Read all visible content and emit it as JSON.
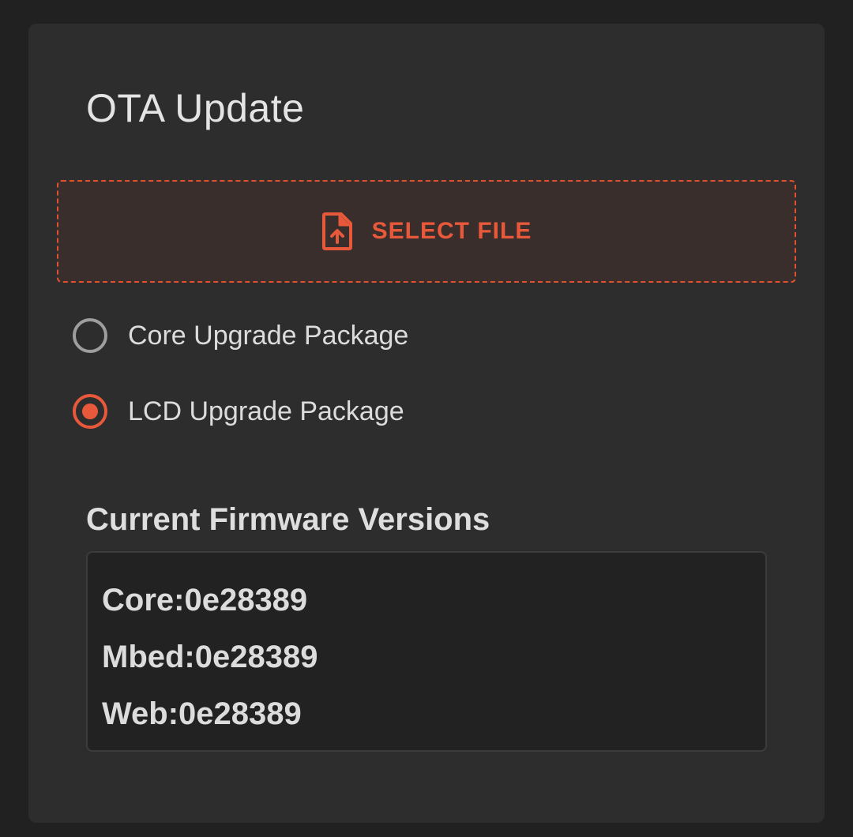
{
  "panel": {
    "title": "OTA Update",
    "select_file": {
      "icon": "file-upload-icon",
      "label": "SELECT FILE"
    },
    "package_options": [
      {
        "label": "Core Upgrade Package",
        "selected": false
      },
      {
        "label": "LCD Upgrade Package",
        "selected": true
      }
    ],
    "firmware": {
      "heading": "Current Firmware Versions",
      "lines": [
        "Core:0e28389",
        "Mbed:0e28389",
        "Web:0e28389"
      ]
    }
  },
  "colors": {
    "accent": "#e8583a",
    "background": "#212121",
    "card": "#2d2d2d"
  }
}
